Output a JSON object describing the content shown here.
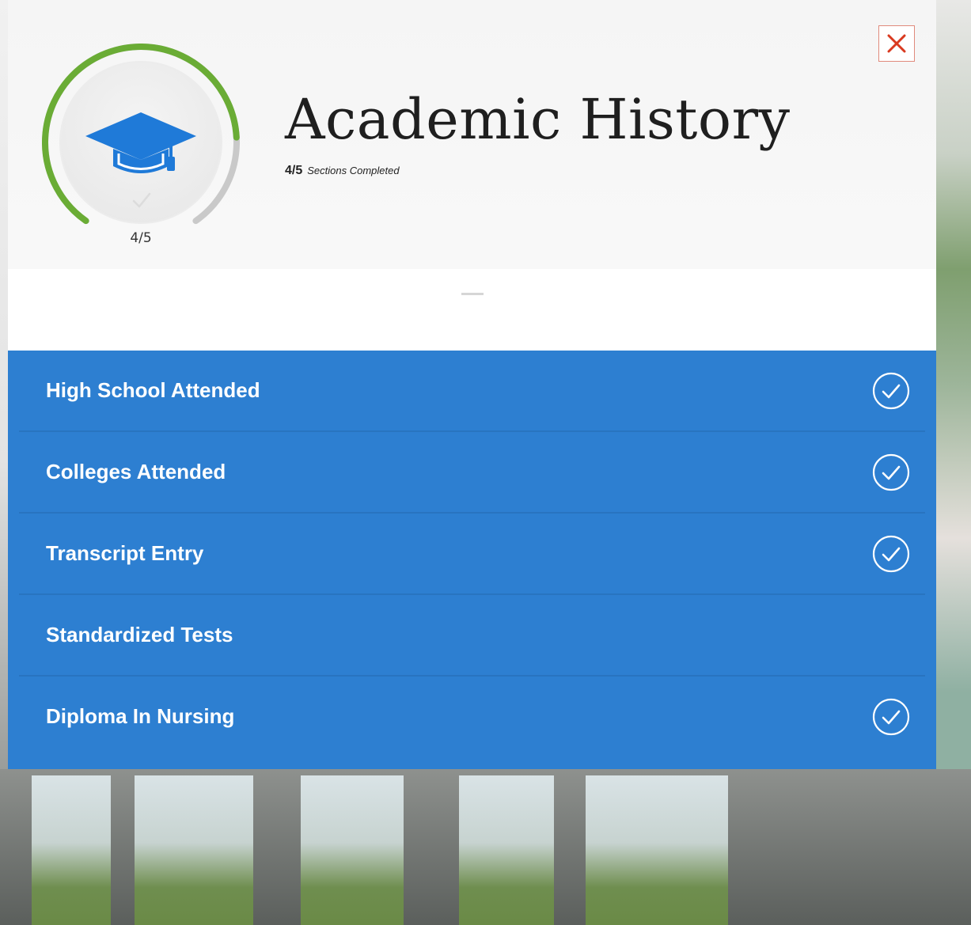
{
  "header": {
    "title": "Academic History",
    "progress_count": "4/5",
    "progress_label": "Sections Completed",
    "ring_count": "4/5",
    "ring_progress": 0.8,
    "ring_icon": "graduation-cap-icon",
    "close_icon": "close-icon"
  },
  "sections": [
    {
      "label": "High School Attended",
      "completed": true
    },
    {
      "label": "Colleges Attended",
      "completed": true
    },
    {
      "label": "Transcript Entry",
      "completed": true
    },
    {
      "label": "Standardized Tests",
      "completed": false
    },
    {
      "label": "Diploma In Nursing",
      "completed": true
    }
  ],
  "colors": {
    "accent_blue": "#2d7fd1",
    "ring_green": "#6aac35",
    "ring_gray": "#c9c9c9",
    "cap_blue": "#1f7ad8",
    "close_red": "#d9391f"
  }
}
